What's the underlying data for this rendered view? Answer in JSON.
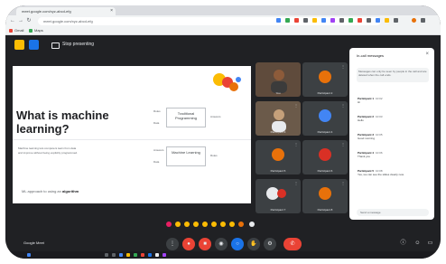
{
  "browser": {
    "tab_title": "meet.google.com/xyz-abcd-efg",
    "url": "meet.google.com/xyz-abcd-efg",
    "bookmarks": [
      "Gmail",
      "Maps"
    ]
  },
  "meet": {
    "presenting_label": "Stop presenting"
  },
  "slide": {
    "title_line1": "What is machine",
    "title_line2": "learning?",
    "description": "Machine learning lets computers learn from data and improve without being explicitly programmed.",
    "footer_prefix": "ML approach to using an",
    "footer_bold": "algorithm",
    "labels": [
      "Rules",
      "Data",
      "Answers",
      "Answers",
      "Data",
      "Rules"
    ],
    "box1": "Traditional Programming",
    "box2": "Machine Learning"
  },
  "participants": [
    {
      "name": "You",
      "color": "#fbbc04"
    },
    {
      "name": "Participant 2",
      "color": "#e8710a"
    },
    {
      "name": "Participant 3",
      "color": "#c5a07a"
    },
    {
      "name": "Participant 4",
      "color": "#4285f4"
    },
    {
      "name": "Participant 5",
      "color": "#e8710a"
    },
    {
      "name": "Participant 6",
      "color": "#d93025"
    },
    {
      "name": "Participant 7",
      "color": "#e8eaed"
    },
    {
      "name": "Participant 8",
      "color": "#e8710a"
    }
  ],
  "chat": {
    "title": "In-call messages",
    "info": "Messages can only be seen by people in the call and are deleted when the call ends.",
    "messages": [
      {
        "name": "Participant 1",
        "time": "10:02",
        "text": "Hi"
      },
      {
        "name": "Participant 2",
        "time": "10:03",
        "text": "Hello"
      },
      {
        "name": "Participant 3",
        "time": "10:05",
        "text": "Good morning"
      },
      {
        "name": "Participant 4",
        "time": "10:06",
        "text": "Thank you"
      },
      {
        "name": "Participant 5",
        "time": "10:08",
        "text": "Yes, we can see the slides clearly now."
      }
    ],
    "input_placeholder": "Send a message"
  },
  "controls": {
    "meeting_title": "Google Meet"
  },
  "colors": {
    "accent_blue": "#1a73e8",
    "end_call_red": "#ea4335",
    "meet_yellow": "#fbbc04"
  }
}
